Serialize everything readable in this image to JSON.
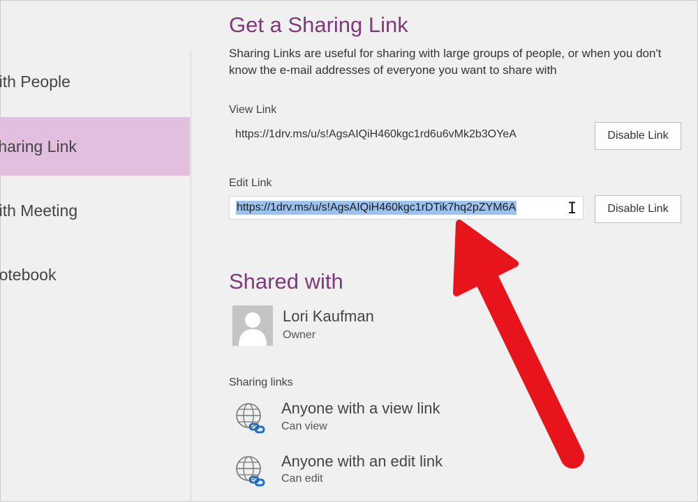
{
  "nav": {
    "items": [
      {
        "label": "with People"
      },
      {
        "label": "Sharing Link"
      },
      {
        "label": "with Meeting"
      },
      {
        "label": "Notebook"
      }
    ]
  },
  "sharing_link": {
    "title": "Get a Sharing Link",
    "description": "Sharing Links are useful for sharing with large groups of people, or when you don't know the e-mail addresses of everyone you want to share with",
    "view_link_label": "View Link",
    "view_link_url": "https://1drv.ms/u/s!AgsAIQiH460kgc1rd6u6vMk2b3OYeA",
    "edit_link_label": "Edit Link",
    "edit_link_url": "https://1drv.ms/u/s!AgsAIQiH460kgc1rDTik7hq2pZYM6A",
    "disable_button_label": "Disable Link"
  },
  "shared_with": {
    "title": "Shared with",
    "person_name": "Lori Kaufman",
    "person_role": "Owner",
    "sharing_links_header": "Sharing links",
    "links": [
      {
        "title": "Anyone with a view link",
        "permission": "Can view"
      },
      {
        "title": "Anyone with an edit link",
        "permission": "Can edit"
      }
    ]
  },
  "colors": {
    "accent": "#80397b",
    "nav_active": "#e2bfdf",
    "selection": "#9cc3ee",
    "annotation_arrow": "#e8141b",
    "link_badge": "#1f6fc1"
  },
  "icons": [
    "person-avatar-icon",
    "globe-link-icon",
    "text-cursor-icon"
  ]
}
